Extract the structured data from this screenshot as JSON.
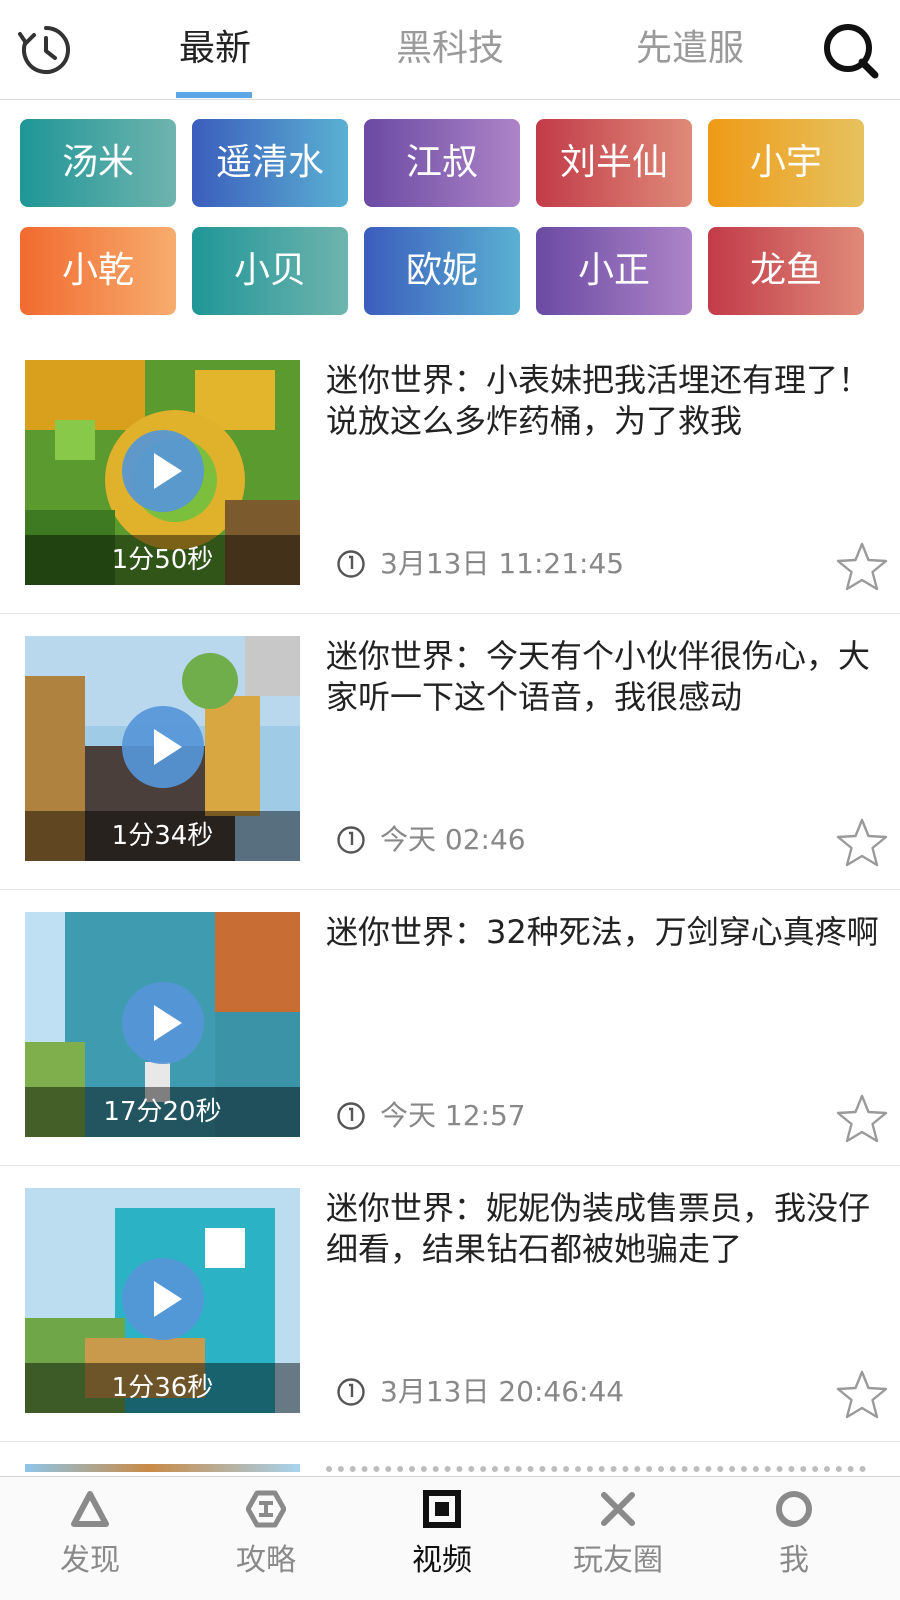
{
  "header": {
    "tabs": [
      {
        "label": "最新",
        "active": true
      },
      {
        "label": "黑科技",
        "active": false
      },
      {
        "label": "先遣服",
        "active": false
      }
    ],
    "icons": {
      "left": "history-clock-icon",
      "right": "search-icon"
    },
    "accent_color": "#5ea7e6"
  },
  "authors": [
    {
      "name": "汤米",
      "color": "teal"
    },
    {
      "name": "遥清水",
      "color": "blue"
    },
    {
      "name": "江叔",
      "color": "purple"
    },
    {
      "name": "刘半仙",
      "color": "red"
    },
    {
      "name": "小宇",
      "color": "yellow"
    },
    {
      "name": "小乾",
      "color": "orange"
    },
    {
      "name": "小贝",
      "color": "teal"
    },
    {
      "name": "欧妮",
      "color": "blue"
    },
    {
      "name": "小正",
      "color": "purple"
    },
    {
      "name": "龙鱼",
      "color": "red"
    }
  ],
  "videos": [
    {
      "title": "迷你世界：小表妹把我活埋还有理了！说放这么多炸药桶，为了救我",
      "duration": "1分50秒",
      "time": "3月13日 11:21:45"
    },
    {
      "title": "迷你世界：今天有个小伙伴很伤心，大家听一下这个语音，我很感动",
      "duration": "1分34秒",
      "time": "今天 02:46"
    },
    {
      "title": "迷你世界：32种死法，万剑穿心真疼啊",
      "duration": "17分20秒",
      "time": "今天 12:57"
    },
    {
      "title": "迷你世界：妮妮伪装成售票员，我没仔细看，结果钻石都被她骗走了",
      "duration": "1分36秒",
      "time": "3月13日 20:46:44"
    }
  ],
  "bottom_nav": [
    {
      "label": "发现",
      "icon": "triangle-icon",
      "active": false
    },
    {
      "label": "攻略",
      "icon": "hexagon-icon",
      "active": false
    },
    {
      "label": "视频",
      "icon": "square-icon",
      "active": true
    },
    {
      "label": "玩友圈",
      "icon": "cross-icon",
      "active": false
    },
    {
      "label": "我",
      "icon": "circle-icon",
      "active": false
    }
  ]
}
